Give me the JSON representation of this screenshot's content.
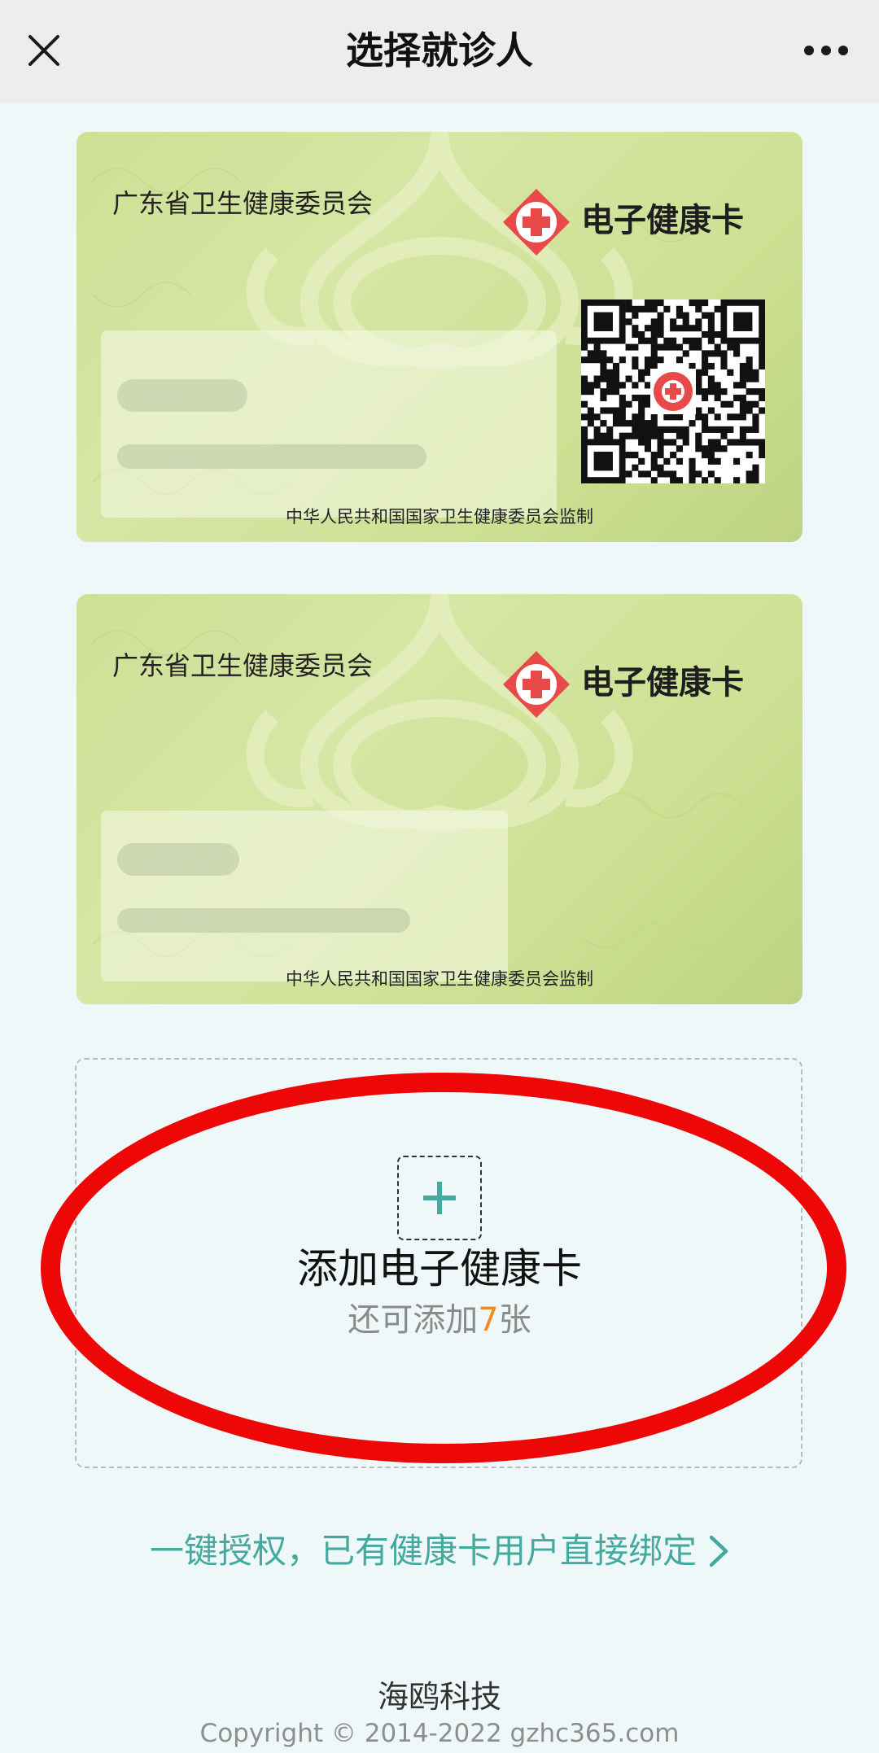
{
  "header": {
    "title": "选择就诊人",
    "close_icon": "close-icon",
    "more_icon": "more-icon"
  },
  "cards": [
    {
      "issuer": "广东省卫生健康委员会",
      "brand": "电子健康卡",
      "logo_icon": "red-cross-logo-icon",
      "qr_icon": "qr-code-icon",
      "supervisor": "中华人民共和国国家卫生健康委员会监制"
    },
    {
      "issuer": "广东省卫生健康委员会",
      "brand": "电子健康卡",
      "logo_icon": "red-cross-logo-icon",
      "supervisor": "中华人民共和国国家卫生健康委员会监制"
    }
  ],
  "add_card": {
    "title": "添加电子健康卡",
    "remaining_prefix": "还可添加",
    "remaining_count": "7",
    "remaining_suffix": "张",
    "plus_icon": "plus-icon"
  },
  "bind": {
    "label": "一键授权，已有健康卡用户直接绑定",
    "chevron_icon": "chevron-right-icon"
  },
  "footer": {
    "company": "海鸥科技",
    "copyright": "Copyright © 2014-2022 gzhc365.com"
  },
  "colors": {
    "accent": "#45a9a0",
    "highlight": "#f08a20",
    "annotation": "#ee0707",
    "card_green": "#d3e39d",
    "logo_red": "#e84a4a"
  }
}
